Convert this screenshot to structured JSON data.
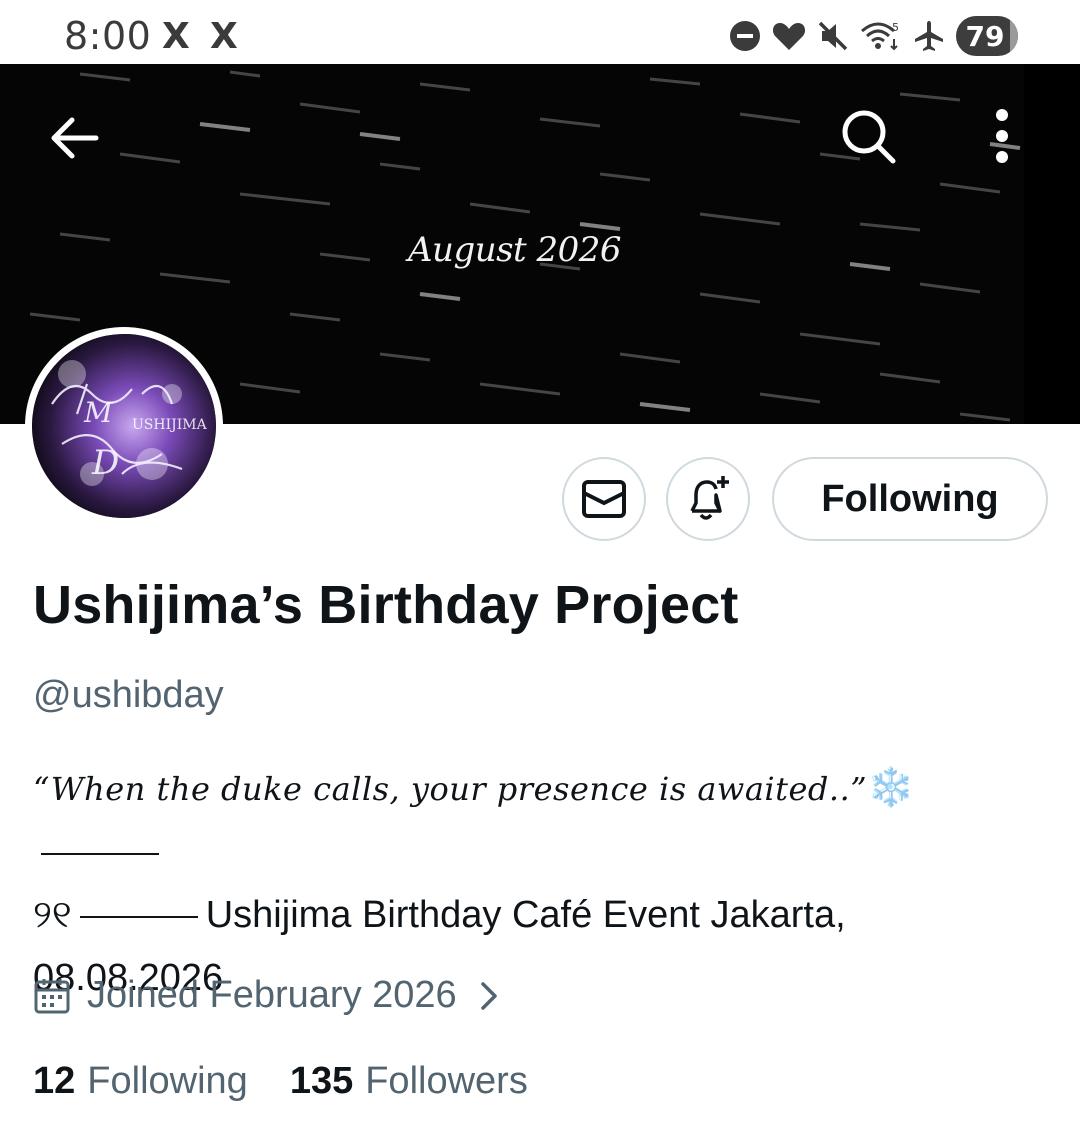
{
  "status_bar": {
    "time": "8:00",
    "app_icons": [
      "X",
      "X"
    ],
    "icons": [
      "dnd-icon",
      "heart-icon",
      "mute-icon",
      "wifi-icon",
      "airplane-icon"
    ],
    "battery": "79"
  },
  "header": {
    "banner_text": "August 2026",
    "icons": [
      "back-arrow-icon",
      "search-icon",
      "more-vertical-icon"
    ]
  },
  "profile": {
    "display_name": "Ushijima’s Birthday Project",
    "handle": "@ushibday",
    "bio_quote": "“When the duke calls, your presence is awaited..”",
    "bio_snowflake": "❄️",
    "bio_symbol": "୨୧",
    "bio_event": "Ushijima Birthday Café Event  Jakarta,",
    "bio_date": "08.08.2026",
    "joined": "Joined February 2026",
    "following_count": "12",
    "following_label": "Following",
    "followers_count": "135",
    "followers_label": "Followers"
  },
  "actions": {
    "message_icon": "mail-icon",
    "notify_icon": "bell-plus-icon",
    "follow_label": "Following"
  },
  "colors": {
    "text": "#0f1419",
    "secondary": "#536471",
    "border": "#cfd9de",
    "banner_bg": "#050505",
    "avatar_accent": "#8a5cc8"
  }
}
